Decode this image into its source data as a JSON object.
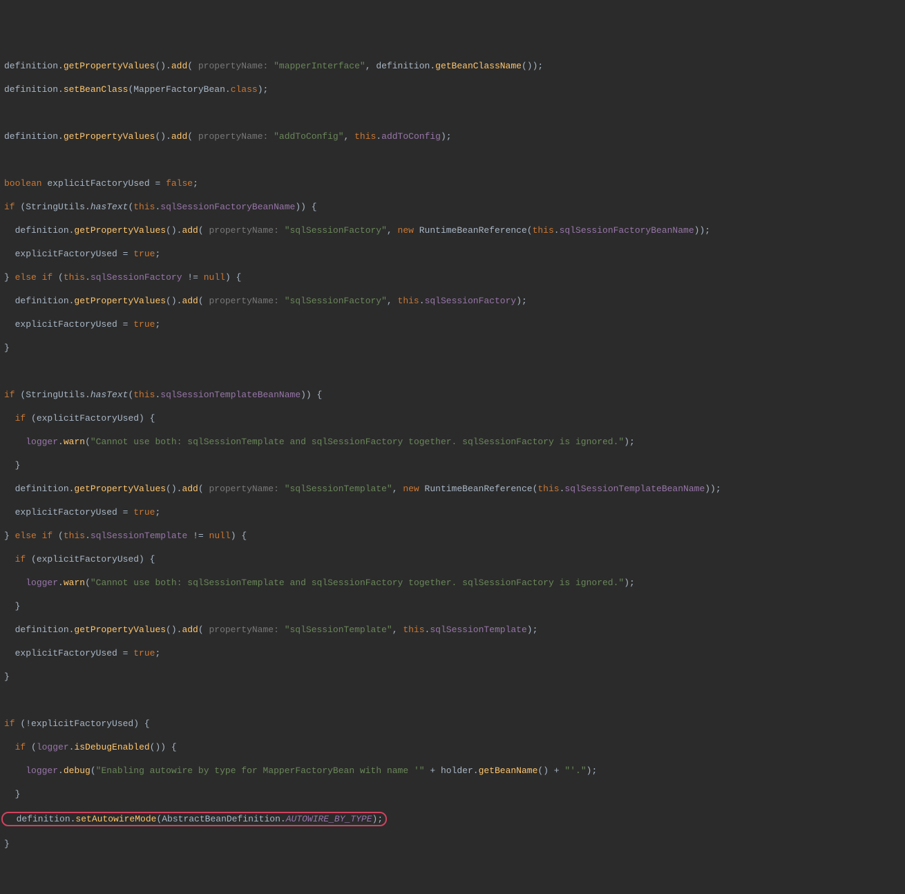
{
  "code": {
    "l0_a": "definition.",
    "l0_m1": "getPropertyValues",
    "l0_b": "().",
    "l0_m2": "add",
    "l0_c": "( ",
    "l0_hint": "propertyName: ",
    "l0_s": "\"mapperInterface\"",
    "l0_d": ", definition.",
    "l0_m3": "getBeanClassName",
    "l0_e": "());",
    "l1_a": "definition.",
    "l1_m1": "setBeanClass",
    "l1_b": "(MapperFactoryBean.",
    "l1_kw": "class",
    "l1_c": ");",
    "l3_a": "definition.",
    "l3_m1": "getPropertyValues",
    "l3_b": "().",
    "l3_m2": "add",
    "l3_c": "( ",
    "l3_hint": "propertyName: ",
    "l3_s": "\"addToConfig\"",
    "l3_d": ", ",
    "l3_kw": "this",
    "l3_e": ".",
    "l3_f": "addToConfig",
    "l3_g": ");",
    "l5_kw1": "boolean ",
    "l5_a": "explicitFactoryUsed = ",
    "l5_kw2": "false",
    "l5_b": ";",
    "l6_kw": "if ",
    "l6_a": "(StringUtils.",
    "l6_m": "hasText",
    "l6_b": "(",
    "l6_kw2": "this",
    "l6_c": ".",
    "l6_f": "sqlSessionFactoryBeanName",
    "l6_d": ")) {",
    "l7_a": "  definition.",
    "l7_m1": "getPropertyValues",
    "l7_b": "().",
    "l7_m2": "add",
    "l7_c": "( ",
    "l7_hint": "propertyName: ",
    "l7_s": "\"sqlSessionFactory\"",
    "l7_d": ", ",
    "l7_kw": "new ",
    "l7_e": "RuntimeBeanReference(",
    "l7_kw2": "this",
    "l7_f": ".",
    "l7_g": "sqlSessionFactoryBeanName",
    "l7_h": "));",
    "l8_a": "  explicitFactoryUsed = ",
    "l8_kw": "true",
    "l8_b": ";",
    "l9_a": "} ",
    "l9_kw": "else if ",
    "l9_b": "(",
    "l9_kw2": "this",
    "l9_c": ".",
    "l9_f": "sqlSessionFactory",
    "l9_d": " != ",
    "l9_kw3": "null",
    "l9_e": ") {",
    "l10_a": "  definition.",
    "l10_m1": "getPropertyValues",
    "l10_b": "().",
    "l10_m2": "add",
    "l10_c": "( ",
    "l10_hint": "propertyName: ",
    "l10_s": "\"sqlSessionFactory\"",
    "l10_d": ", ",
    "l10_kw": "this",
    "l10_e": ".",
    "l10_f": "sqlSessionFactory",
    "l10_g": ");",
    "l11_a": "  explicitFactoryUsed = ",
    "l11_kw": "true",
    "l11_b": ";",
    "l12_a": "}",
    "l14_kw": "if ",
    "l14_a": "(StringUtils.",
    "l14_m": "hasText",
    "l14_b": "(",
    "l14_kw2": "this",
    "l14_c": ".",
    "l14_f": "sqlSessionTemplateBeanName",
    "l14_d": ")) {",
    "l15_kw": "  if ",
    "l15_a": "(explicitFactoryUsed) {",
    "l16_a": "    ",
    "l16_f": "logger",
    "l16_b": ".",
    "l16_m": "warn",
    "l16_c": "(",
    "l16_s": "\"Cannot use both: sqlSessionTemplate and sqlSessionFactory together. sqlSessionFactory is ignored.\"",
    "l16_d": ");",
    "l17_a": "  }",
    "l18_a": "  definition.",
    "l18_m1": "getPropertyValues",
    "l18_b": "().",
    "l18_m2": "add",
    "l18_c": "( ",
    "l18_hint": "propertyName: ",
    "l18_s": "\"sqlSessionTemplate\"",
    "l18_d": ", ",
    "l18_kw": "new ",
    "l18_e": "RuntimeBeanReference(",
    "l18_kw2": "this",
    "l18_f": ".",
    "l18_g": "sqlSessionTemplateBeanName",
    "l18_h": "));",
    "l19_a": "  explicitFactoryUsed = ",
    "l19_kw": "true",
    "l19_b": ";",
    "l20_a": "} ",
    "l20_kw": "else if ",
    "l20_b": "(",
    "l20_kw2": "this",
    "l20_c": ".",
    "l20_f": "sqlSessionTemplate",
    "l20_d": " != ",
    "l20_kw3": "null",
    "l20_e": ") {",
    "l21_kw": "  if ",
    "l21_a": "(explicitFactoryUsed) {",
    "l22_a": "    ",
    "l22_f": "logger",
    "l22_b": ".",
    "l22_m": "warn",
    "l22_c": "(",
    "l22_s": "\"Cannot use both: sqlSessionTemplate and sqlSessionFactory together. sqlSessionFactory is ignored.\"",
    "l22_d": ");",
    "l23_a": "  }",
    "l24_a": "  definition.",
    "l24_m1": "getPropertyValues",
    "l24_b": "().",
    "l24_m2": "add",
    "l24_c": "( ",
    "l24_hint": "propertyName: ",
    "l24_s": "\"sqlSessionTemplate\"",
    "l24_d": ", ",
    "l24_kw": "this",
    "l24_e": ".",
    "l24_f": "sqlSessionTemplate",
    "l24_g": ");",
    "l25_a": "  explicitFactoryUsed = ",
    "l25_kw": "true",
    "l25_b": ";",
    "l26_a": "}",
    "l28_kw": "if ",
    "l28_a": "(!explicitFactoryUsed) {",
    "l29_kw": "  if ",
    "l29_a": "(",
    "l29_f": "logger",
    "l29_b": ".",
    "l29_m": "isDebugEnabled",
    "l29_c": "()) {",
    "l30_a": "    ",
    "l30_f": "logger",
    "l30_b": ".",
    "l30_m": "debug",
    "l30_c": "(",
    "l30_s1": "\"Enabling autowire by type for MapperFactoryBean with name '\"",
    "l30_d": " + holder.",
    "l30_m2": "getBeanName",
    "l30_e": "() + ",
    "l30_s2": "\"'.\"",
    "l30_g": ");",
    "l31_a": "  }",
    "l32_a": "  definition.",
    "l32_m": "setAutowireMode",
    "l32_b": "(AbstractBeanDefinition.",
    "l32_c": "AUTOWIRE_BY_TYPE",
    "l32_d": ");",
    "l33_a": "}"
  }
}
